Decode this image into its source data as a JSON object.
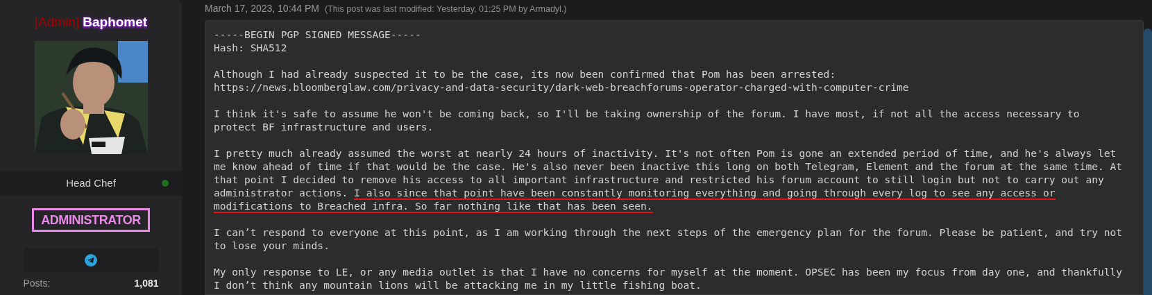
{
  "author": {
    "role_tag": "[Admin]",
    "username": "Baphomet",
    "title": "Head Chef",
    "online": true,
    "group_badge": "ADMINISTRATOR",
    "contacts": [
      {
        "kind": "telegram"
      }
    ],
    "stats": [
      {
        "label": "Posts:",
        "value": "1,081"
      }
    ]
  },
  "post": {
    "date": "March 17, 2023, 10:44 PM",
    "edit_note": "(This post was last modified: Yesterday, 01:25 PM by Armadyl.)",
    "paragraphs": [
      [
        [
          {
            "text": "-----BEGIN PGP SIGNED MESSAGE-----",
            "underlined": false
          }
        ],
        [
          {
            "text": "Hash: SHA512",
            "underlined": false
          }
        ]
      ],
      [
        [
          {
            "text": "Although I had already suspected it to be the case, its now been confirmed that Pom has been arrested:",
            "underlined": false
          }
        ],
        [
          {
            "text": "https://news.bloomberglaw.com/privacy-and-data-security/dark-web-breachforums-operator-charged-with-computer-crime",
            "underlined": false
          }
        ]
      ],
      [
        [
          {
            "text": "I think it's safe to assume he won't be coming back, so I'll be taking ownership of the forum. I have most, if not all the access necessary to",
            "underlined": false
          }
        ],
        [
          {
            "text": "protect BF infrastructure and users.",
            "underlined": false
          }
        ]
      ],
      [
        [
          {
            "text": "I pretty much already assumed the worst at nearly 24 hours of inactivity. It's not often Pom is gone an extended period of time, and he's always let",
            "underlined": false
          }
        ],
        [
          {
            "text": "me know ahead of time if that would be the case. He's also never been inactive this long on both Telegram, Element and the forum at the same time. At",
            "underlined": false
          }
        ],
        [
          {
            "text": "that point I decided to remove his access to all important infrastructure and restricted his forum account to still login but not to carry out any",
            "underlined": false
          }
        ],
        [
          {
            "text": "administrator actions. ",
            "underlined": false
          },
          {
            "text": "I also since that point have been constantly monitoring everything and going through every log to see any access or",
            "underlined": true
          }
        ],
        [
          {
            "text": "modifications to Breached infra. So far nothing like that has been seen.",
            "underlined": true
          }
        ]
      ],
      [
        [
          {
            "text": "I can’t respond to everyone at this point, as I am working through the next steps of the emergency plan for the forum. Please be patient, and try not",
            "underlined": false
          }
        ],
        [
          {
            "text": "to lose your minds.",
            "underlined": false
          }
        ]
      ],
      [
        [
          {
            "text": "My only response to LE, or any media outlet is that I have no concerns for myself at the moment. OPSEC has been my focus from day one, and thankfully",
            "underlined": false
          }
        ],
        [
          {
            "text": "I don’t think any mountain lions will be attacking me in my little fishing boat.",
            "underlined": false
          }
        ]
      ]
    ]
  }
}
